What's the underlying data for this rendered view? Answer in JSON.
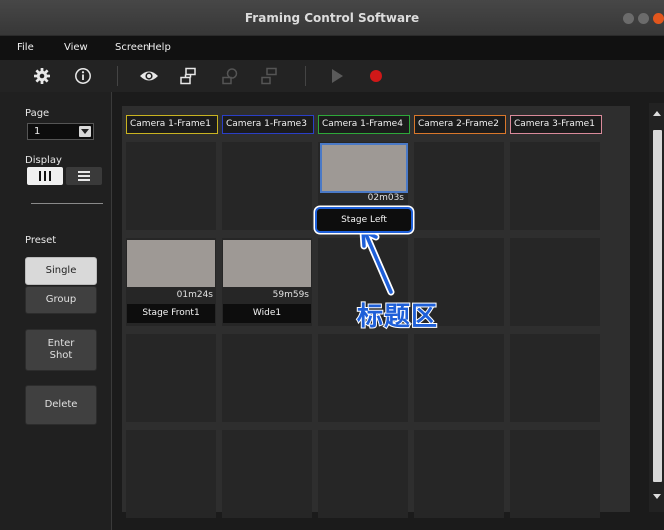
{
  "window": {
    "title": "Framing Control Software"
  },
  "menu": {
    "items": [
      "File",
      "View",
      "Screen",
      "Help"
    ]
  },
  "toolbar": {
    "icons": [
      "gear-icon",
      "info-icon",
      "eye-icon",
      "layout-icon",
      "layout-disabled-icon",
      "frame-disabled-icon",
      "play-icon",
      "record-icon"
    ],
    "colors": {
      "record": "#d01818",
      "icon": "#e8e8e8",
      "disabled": "#555555"
    }
  },
  "sidebar": {
    "page_label": "Page",
    "page_value": "1",
    "display_label": "Display",
    "preset_label": "Preset",
    "single_label": "Single",
    "group_label": "Group",
    "enter_shot_label": "Enter\nShot",
    "delete_label": "Delete"
  },
  "grid": {
    "headers": [
      {
        "label": "Camera 1-Frame1",
        "color": "#c9b320"
      },
      {
        "label": "Camera 1-Frame3",
        "color": "#2a3fc7"
      },
      {
        "label": "Camera 1-Frame4",
        "color": "#2ea83a"
      },
      {
        "label": "Camera 2-Frame2",
        "color": "#d9772b"
      },
      {
        "label": "Camera 3-Frame1",
        "color": "#d98a9a"
      }
    ],
    "shots": [
      {
        "duration": "02m03s",
        "label": "Stage Left"
      },
      {
        "duration": "01m24s",
        "label": "Stage Front1"
      },
      {
        "duration": "59m59s",
        "label": "Wide1"
      }
    ]
  },
  "annotation": {
    "text": "标题区",
    "color": "#1e5fd8"
  }
}
